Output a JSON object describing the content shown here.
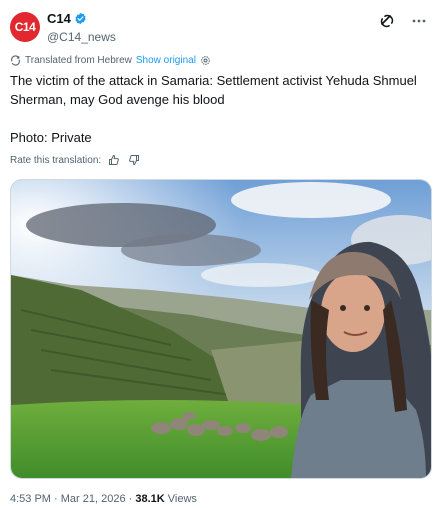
{
  "account": {
    "avatar_text": "C14",
    "avatar_color": "#e0282e",
    "name": "C14",
    "handle": "@C14_news"
  },
  "icons": {
    "verified": "verified-badge-icon",
    "grok": "grok-icon",
    "more": "more-icon",
    "translate": "translate-icon",
    "settings": "gear-icon",
    "thumbs_up": "thumbs-up-icon",
    "thumbs_down": "thumbs-down-icon"
  },
  "translation": {
    "label": "Translated from Hebrew",
    "show_original": "Show original",
    "rate_label": "Rate this translation:"
  },
  "tweet": {
    "text": "The victim of the attack in Samaria: Settlement activist Yehuda Shmuel Sherman, may God avenge his blood\n\nPhoto: Private"
  },
  "meta": {
    "time": "4:53 PM",
    "sep1": " · ",
    "date": "Mar 21, 2026",
    "sep2": " · ",
    "views_count": "38.1K",
    "views_label": " Views"
  },
  "colors": {
    "link": "#1d9bf0",
    "secondary_text": "#536471",
    "verified": "#1d9bf0"
  }
}
